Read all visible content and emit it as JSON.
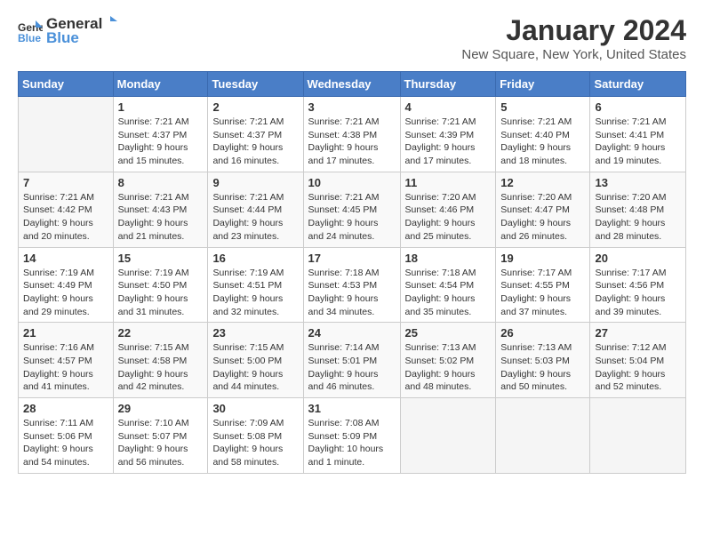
{
  "logo": {
    "text_general": "General",
    "text_blue": "Blue"
  },
  "title": "January 2024",
  "subtitle": "New Square, New York, United States",
  "weekdays": [
    "Sunday",
    "Monday",
    "Tuesday",
    "Wednesday",
    "Thursday",
    "Friday",
    "Saturday"
  ],
  "weeks": [
    [
      {
        "day": "",
        "info": ""
      },
      {
        "day": "1",
        "info": "Sunrise: 7:21 AM\nSunset: 4:37 PM\nDaylight: 9 hours\nand 15 minutes."
      },
      {
        "day": "2",
        "info": "Sunrise: 7:21 AM\nSunset: 4:37 PM\nDaylight: 9 hours\nand 16 minutes."
      },
      {
        "day": "3",
        "info": "Sunrise: 7:21 AM\nSunset: 4:38 PM\nDaylight: 9 hours\nand 17 minutes."
      },
      {
        "day": "4",
        "info": "Sunrise: 7:21 AM\nSunset: 4:39 PM\nDaylight: 9 hours\nand 17 minutes."
      },
      {
        "day": "5",
        "info": "Sunrise: 7:21 AM\nSunset: 4:40 PM\nDaylight: 9 hours\nand 18 minutes."
      },
      {
        "day": "6",
        "info": "Sunrise: 7:21 AM\nSunset: 4:41 PM\nDaylight: 9 hours\nand 19 minutes."
      }
    ],
    [
      {
        "day": "7",
        "info": "Sunrise: 7:21 AM\nSunset: 4:42 PM\nDaylight: 9 hours\nand 20 minutes."
      },
      {
        "day": "8",
        "info": "Sunrise: 7:21 AM\nSunset: 4:43 PM\nDaylight: 9 hours\nand 21 minutes."
      },
      {
        "day": "9",
        "info": "Sunrise: 7:21 AM\nSunset: 4:44 PM\nDaylight: 9 hours\nand 23 minutes."
      },
      {
        "day": "10",
        "info": "Sunrise: 7:21 AM\nSunset: 4:45 PM\nDaylight: 9 hours\nand 24 minutes."
      },
      {
        "day": "11",
        "info": "Sunrise: 7:20 AM\nSunset: 4:46 PM\nDaylight: 9 hours\nand 25 minutes."
      },
      {
        "day": "12",
        "info": "Sunrise: 7:20 AM\nSunset: 4:47 PM\nDaylight: 9 hours\nand 26 minutes."
      },
      {
        "day": "13",
        "info": "Sunrise: 7:20 AM\nSunset: 4:48 PM\nDaylight: 9 hours\nand 28 minutes."
      }
    ],
    [
      {
        "day": "14",
        "info": "Sunrise: 7:19 AM\nSunset: 4:49 PM\nDaylight: 9 hours\nand 29 minutes."
      },
      {
        "day": "15",
        "info": "Sunrise: 7:19 AM\nSunset: 4:50 PM\nDaylight: 9 hours\nand 31 minutes."
      },
      {
        "day": "16",
        "info": "Sunrise: 7:19 AM\nSunset: 4:51 PM\nDaylight: 9 hours\nand 32 minutes."
      },
      {
        "day": "17",
        "info": "Sunrise: 7:18 AM\nSunset: 4:53 PM\nDaylight: 9 hours\nand 34 minutes."
      },
      {
        "day": "18",
        "info": "Sunrise: 7:18 AM\nSunset: 4:54 PM\nDaylight: 9 hours\nand 35 minutes."
      },
      {
        "day": "19",
        "info": "Sunrise: 7:17 AM\nSunset: 4:55 PM\nDaylight: 9 hours\nand 37 minutes."
      },
      {
        "day": "20",
        "info": "Sunrise: 7:17 AM\nSunset: 4:56 PM\nDaylight: 9 hours\nand 39 minutes."
      }
    ],
    [
      {
        "day": "21",
        "info": "Sunrise: 7:16 AM\nSunset: 4:57 PM\nDaylight: 9 hours\nand 41 minutes."
      },
      {
        "day": "22",
        "info": "Sunrise: 7:15 AM\nSunset: 4:58 PM\nDaylight: 9 hours\nand 42 minutes."
      },
      {
        "day": "23",
        "info": "Sunrise: 7:15 AM\nSunset: 5:00 PM\nDaylight: 9 hours\nand 44 minutes."
      },
      {
        "day": "24",
        "info": "Sunrise: 7:14 AM\nSunset: 5:01 PM\nDaylight: 9 hours\nand 46 minutes."
      },
      {
        "day": "25",
        "info": "Sunrise: 7:13 AM\nSunset: 5:02 PM\nDaylight: 9 hours\nand 48 minutes."
      },
      {
        "day": "26",
        "info": "Sunrise: 7:13 AM\nSunset: 5:03 PM\nDaylight: 9 hours\nand 50 minutes."
      },
      {
        "day": "27",
        "info": "Sunrise: 7:12 AM\nSunset: 5:04 PM\nDaylight: 9 hours\nand 52 minutes."
      }
    ],
    [
      {
        "day": "28",
        "info": "Sunrise: 7:11 AM\nSunset: 5:06 PM\nDaylight: 9 hours\nand 54 minutes."
      },
      {
        "day": "29",
        "info": "Sunrise: 7:10 AM\nSunset: 5:07 PM\nDaylight: 9 hours\nand 56 minutes."
      },
      {
        "day": "30",
        "info": "Sunrise: 7:09 AM\nSunset: 5:08 PM\nDaylight: 9 hours\nand 58 minutes."
      },
      {
        "day": "31",
        "info": "Sunrise: 7:08 AM\nSunset: 5:09 PM\nDaylight: 10 hours\nand 1 minute."
      },
      {
        "day": "",
        "info": ""
      },
      {
        "day": "",
        "info": ""
      },
      {
        "day": "",
        "info": ""
      }
    ]
  ]
}
